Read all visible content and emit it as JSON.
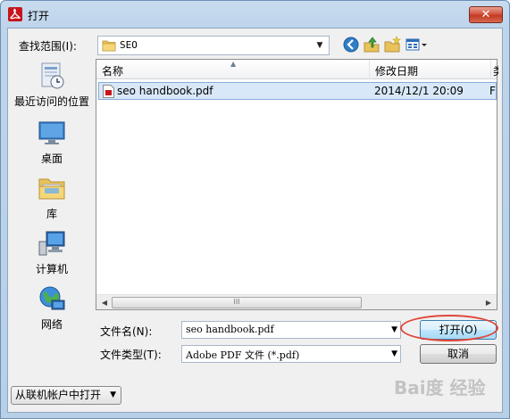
{
  "window": {
    "title": "打开",
    "close_glyph": "✕"
  },
  "lookin": {
    "label": "查找范围(I):",
    "value": "SEO",
    "arrow": "▼"
  },
  "toolbar": {
    "back_icon": "back-icon",
    "up_icon": "up-folder-icon",
    "new_folder_icon": "new-folder-icon",
    "views_icon": "views-menu-icon"
  },
  "places": [
    {
      "label": "最近访问的位置",
      "icon": "recent-places-icon"
    },
    {
      "label": "桌面",
      "icon": "desktop-icon"
    },
    {
      "label": "库",
      "icon": "libraries-icon"
    },
    {
      "label": "计算机",
      "icon": "computer-icon"
    },
    {
      "label": "网络",
      "icon": "network-icon"
    }
  ],
  "filelist": {
    "columns": [
      "名称",
      "修改日期",
      "类"
    ],
    "rows": [
      {
        "name": "seo handbook.pdf",
        "modified": "2014/12/1 20:09",
        "type": "F"
      }
    ],
    "scroll_thumb_grip": "III",
    "scroll_left": "◀",
    "scroll_right": "▶"
  },
  "filename": {
    "label": "文件名(N):",
    "value": "seo handbook.pdf",
    "arrow": "▼"
  },
  "filetype": {
    "label": "文件类型(T):",
    "value": "Adobe PDF 文件 (*.pdf)",
    "arrow": "▼"
  },
  "buttons": {
    "open": "打开(O)",
    "cancel": "取消"
  },
  "offline": {
    "label": "从联机帐户中打开",
    "arrow": "▼"
  },
  "watermark": "Bai度 经验",
  "colors": {
    "selection": "#d8e8f8",
    "highlight_ellipse": "#e0463a",
    "close": "#c23a22"
  }
}
